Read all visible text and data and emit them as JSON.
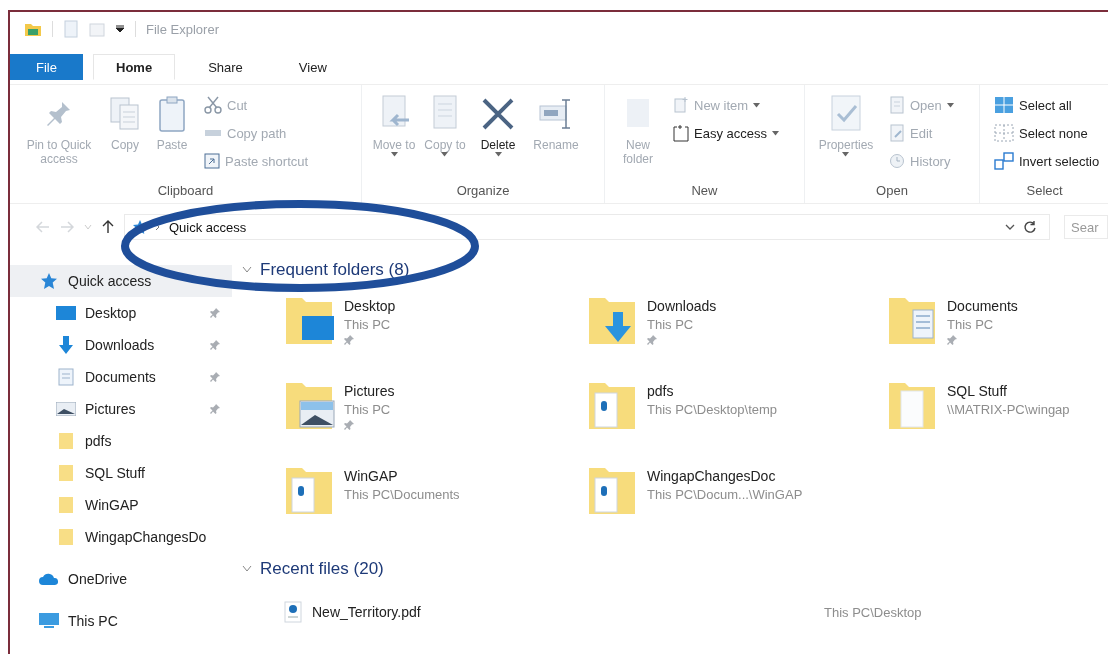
{
  "title_bar": {
    "title": "File Explorer"
  },
  "tabs": [
    {
      "label": "File",
      "kind": "file",
      "selected": false
    },
    {
      "label": "Home",
      "kind": "tab",
      "selected": true
    },
    {
      "label": "Share",
      "kind": "tab",
      "selected": false
    },
    {
      "label": "View",
      "kind": "tab",
      "selected": false
    }
  ],
  "ribbon": {
    "groups": [
      {
        "label": "Clipboard",
        "commands": [
          {
            "label": "Pin to Quick access",
            "kind": "large",
            "disabled": true,
            "dropdown": false
          },
          {
            "label": "Copy",
            "kind": "large",
            "disabled": true,
            "dropdown": false
          },
          {
            "label": "Paste",
            "kind": "large",
            "disabled": true,
            "dropdown": false
          },
          {
            "label": "Cut",
            "kind": "small",
            "disabled": true,
            "dropdown": false
          },
          {
            "label": "Copy path",
            "kind": "small",
            "disabled": true,
            "dropdown": false
          },
          {
            "label": "Paste shortcut",
            "kind": "small",
            "disabled": true,
            "dropdown": false
          }
        ]
      },
      {
        "label": "Organize",
        "commands": [
          {
            "label": "Move to",
            "kind": "large",
            "disabled": true,
            "dropdown": true
          },
          {
            "label": "Copy to",
            "kind": "large",
            "disabled": true,
            "dropdown": true
          },
          {
            "label": "Delete",
            "kind": "large",
            "disabled": false,
            "dropdown": true
          },
          {
            "label": "Rename",
            "kind": "large",
            "disabled": true,
            "dropdown": false
          }
        ]
      },
      {
        "label": "New",
        "commands": [
          {
            "label": "New folder",
            "kind": "large",
            "disabled": true,
            "dropdown": false
          },
          {
            "label": "New item",
            "kind": "small",
            "disabled": true,
            "dropdown": true
          },
          {
            "label": "Easy access",
            "kind": "small",
            "disabled": false,
            "dropdown": true
          }
        ]
      },
      {
        "label": "Open",
        "commands": [
          {
            "label": "Properties",
            "kind": "large",
            "disabled": true,
            "dropdown": true
          },
          {
            "label": "Open",
            "kind": "small",
            "disabled": true,
            "dropdown": true
          },
          {
            "label": "Edit",
            "kind": "small",
            "disabled": true,
            "dropdown": false
          },
          {
            "label": "History",
            "kind": "small",
            "disabled": true,
            "dropdown": false
          }
        ]
      },
      {
        "label": "Select",
        "commands": [
          {
            "label": "Select all",
            "kind": "small",
            "disabled": false,
            "dropdown": false
          },
          {
            "label": "Select none",
            "kind": "small",
            "disabled": false,
            "dropdown": false
          },
          {
            "label": "Invert selectio",
            "kind": "small",
            "disabled": false,
            "dropdown": false
          }
        ]
      }
    ]
  },
  "address_bar": {
    "path": [
      "Quick access"
    ],
    "search": {
      "placeholder": "Sear"
    }
  },
  "sidebar": {
    "items": [
      {
        "label": "Quick access",
        "selected": true,
        "children": [
          {
            "label": "Desktop",
            "pinned": true,
            "selected": false
          },
          {
            "label": "Downloads",
            "pinned": true,
            "selected": false
          },
          {
            "label": "Documents",
            "pinned": true,
            "selected": false
          },
          {
            "label": "Pictures",
            "pinned": true,
            "selected": false
          },
          {
            "label": "pdfs",
            "pinned": false,
            "selected": false
          },
          {
            "label": "SQL Stuff",
            "pinned": false,
            "selected": false
          },
          {
            "label": "WinGAP",
            "pinned": false,
            "selected": false
          },
          {
            "label": "WingapChangesDo",
            "pinned": false,
            "selected": false
          }
        ]
      },
      {
        "label": "OneDrive",
        "selected": false
      },
      {
        "label": "This PC",
        "selected": false
      }
    ]
  },
  "frequent_folders": {
    "title": "Frequent folders (8)",
    "expanded": true,
    "folders": [
      {
        "name": "Desktop",
        "path": "This PC",
        "pinned": true
      },
      {
        "name": "Downloads",
        "path": "This PC",
        "pinned": true
      },
      {
        "name": "Documents",
        "path": "This PC",
        "pinned": true
      },
      {
        "name": "Pictures",
        "path": "This PC",
        "pinned": true
      },
      {
        "name": "pdfs",
        "path": "This PC\\Desktop\\temp",
        "pinned": false
      },
      {
        "name": "SQL Stuff",
        "path": "\\\\MATRIX-PC\\wingap",
        "pinned": false
      },
      {
        "name": "WinGAP",
        "path": "This PC\\Documents",
        "pinned": false
      },
      {
        "name": "WingapChangesDoc",
        "path": "This PC\\Docum...\\WinGAP",
        "pinned": false
      }
    ]
  },
  "recent_files": {
    "title": "Recent files (20)",
    "expanded": true,
    "files": [
      {
        "name": "New_Territory.pdf",
        "path": "This PC\\Desktop"
      }
    ]
  },
  "annotation": {
    "kind": "circle"
  }
}
